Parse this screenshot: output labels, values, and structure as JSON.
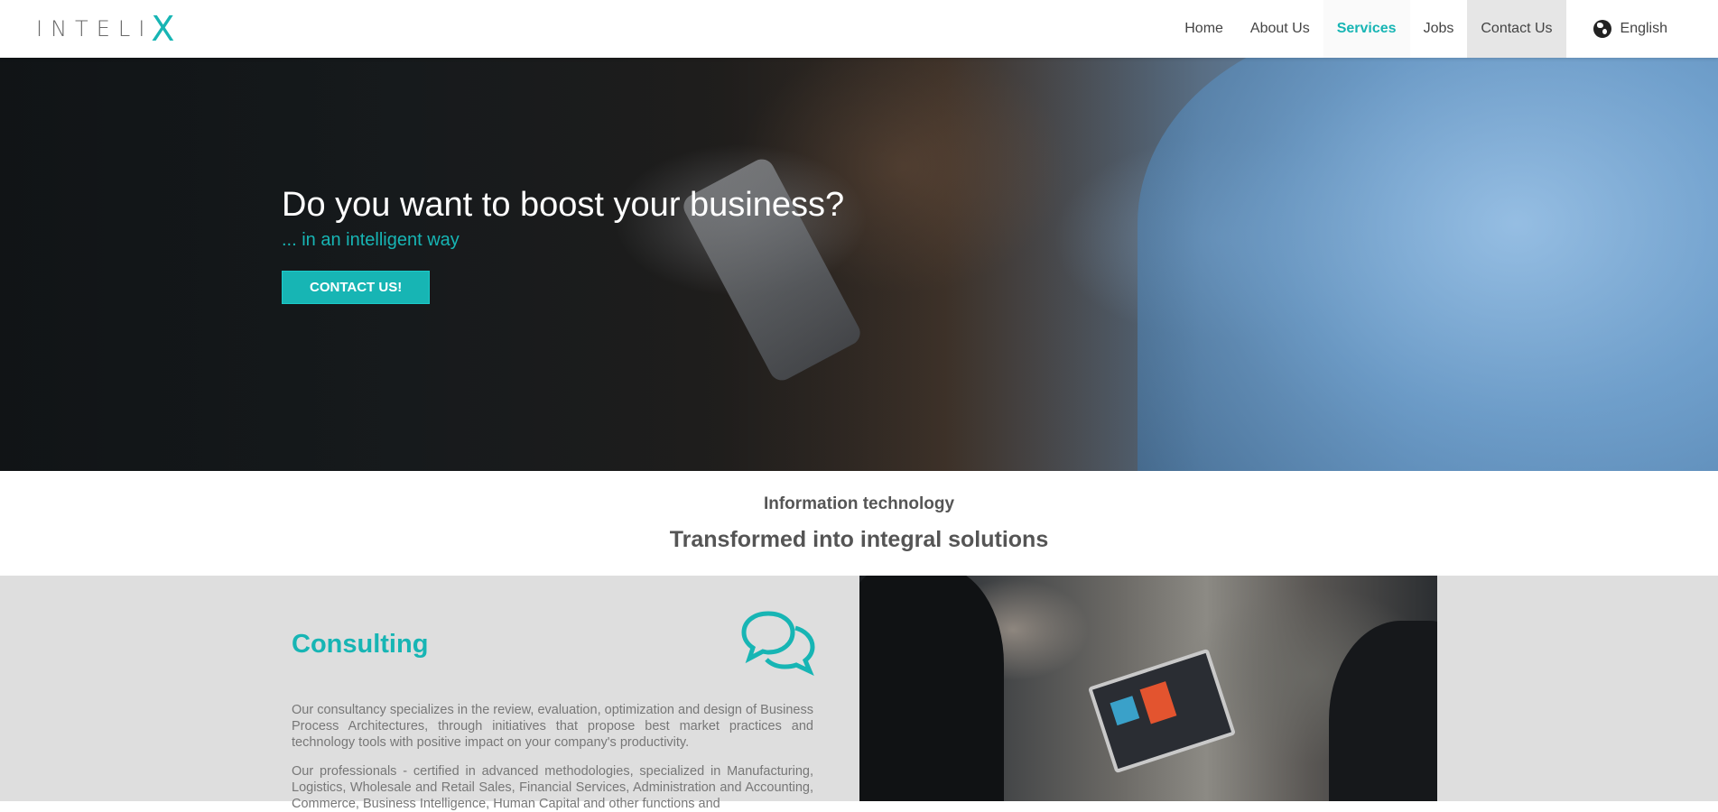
{
  "header": {
    "logo_text": "INTELI",
    "logo_accent": "X",
    "nav": [
      "Home",
      "About Us",
      "Services",
      "Jobs",
      "Contact Us"
    ],
    "active_nav": "Services",
    "language": "English",
    "language_icon": "globe-icon"
  },
  "hero": {
    "title": "Do you want to boost your business?",
    "subtitle": "... in an intelligent way",
    "button": "CONTACT US!"
  },
  "intro": {
    "kicker": "Information technology",
    "headline": "Transformed into integral solutions"
  },
  "consulting": {
    "title": "Consulting",
    "icon": "chat-bubbles-icon",
    "para1": "Our consultancy specializes in the review, evaluation, optimization and design of Business Process Architectures, through initiatives that propose best market practices and technology tools with positive impact on your company's productivity.",
    "para2": "Our professionals - certified in advanced methodologies, specialized in Manufacturing, Logistics, Wholesale and Retail Sales, Financial Services, Administration and Accounting, Commerce, Business Intelligence, Human Capital and other functions and"
  },
  "colors": {
    "accent": "#17b5b4",
    "text": "#555555",
    "section_bg": "#dedede"
  }
}
